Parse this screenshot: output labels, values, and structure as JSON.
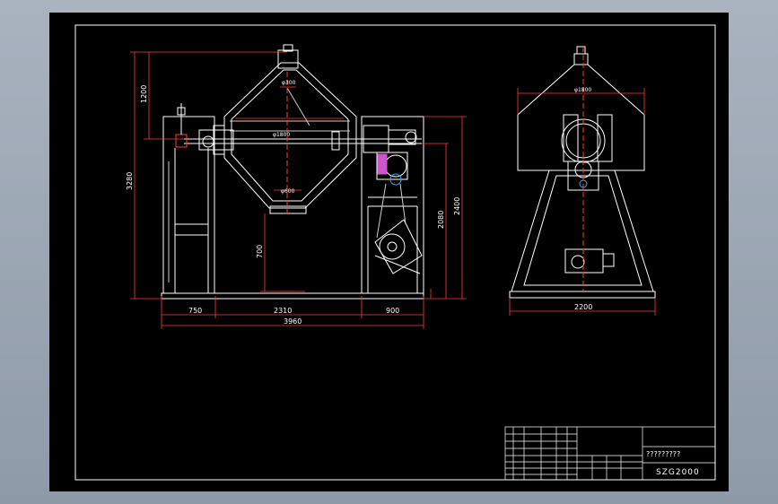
{
  "drawing": {
    "front_view": {
      "dim_overall_width": "3960",
      "dim_left": "750",
      "dim_center": "2310",
      "dim_right": "900",
      "dim_total_height": "3280",
      "dim_top": "1200",
      "dim_height_2400": "2400",
      "dim_height_2080": "2080",
      "dim_shaft_height": "700",
      "dia_top": "φ300",
      "dia_mid": "φ1800",
      "dia_bottom": "φ600"
    },
    "side_view": {
      "dim_base_width": "2200",
      "dia_vessel": "φ1800"
    },
    "title_block": {
      "project_title": "?????????",
      "drawing_no": "SZG2000"
    }
  }
}
